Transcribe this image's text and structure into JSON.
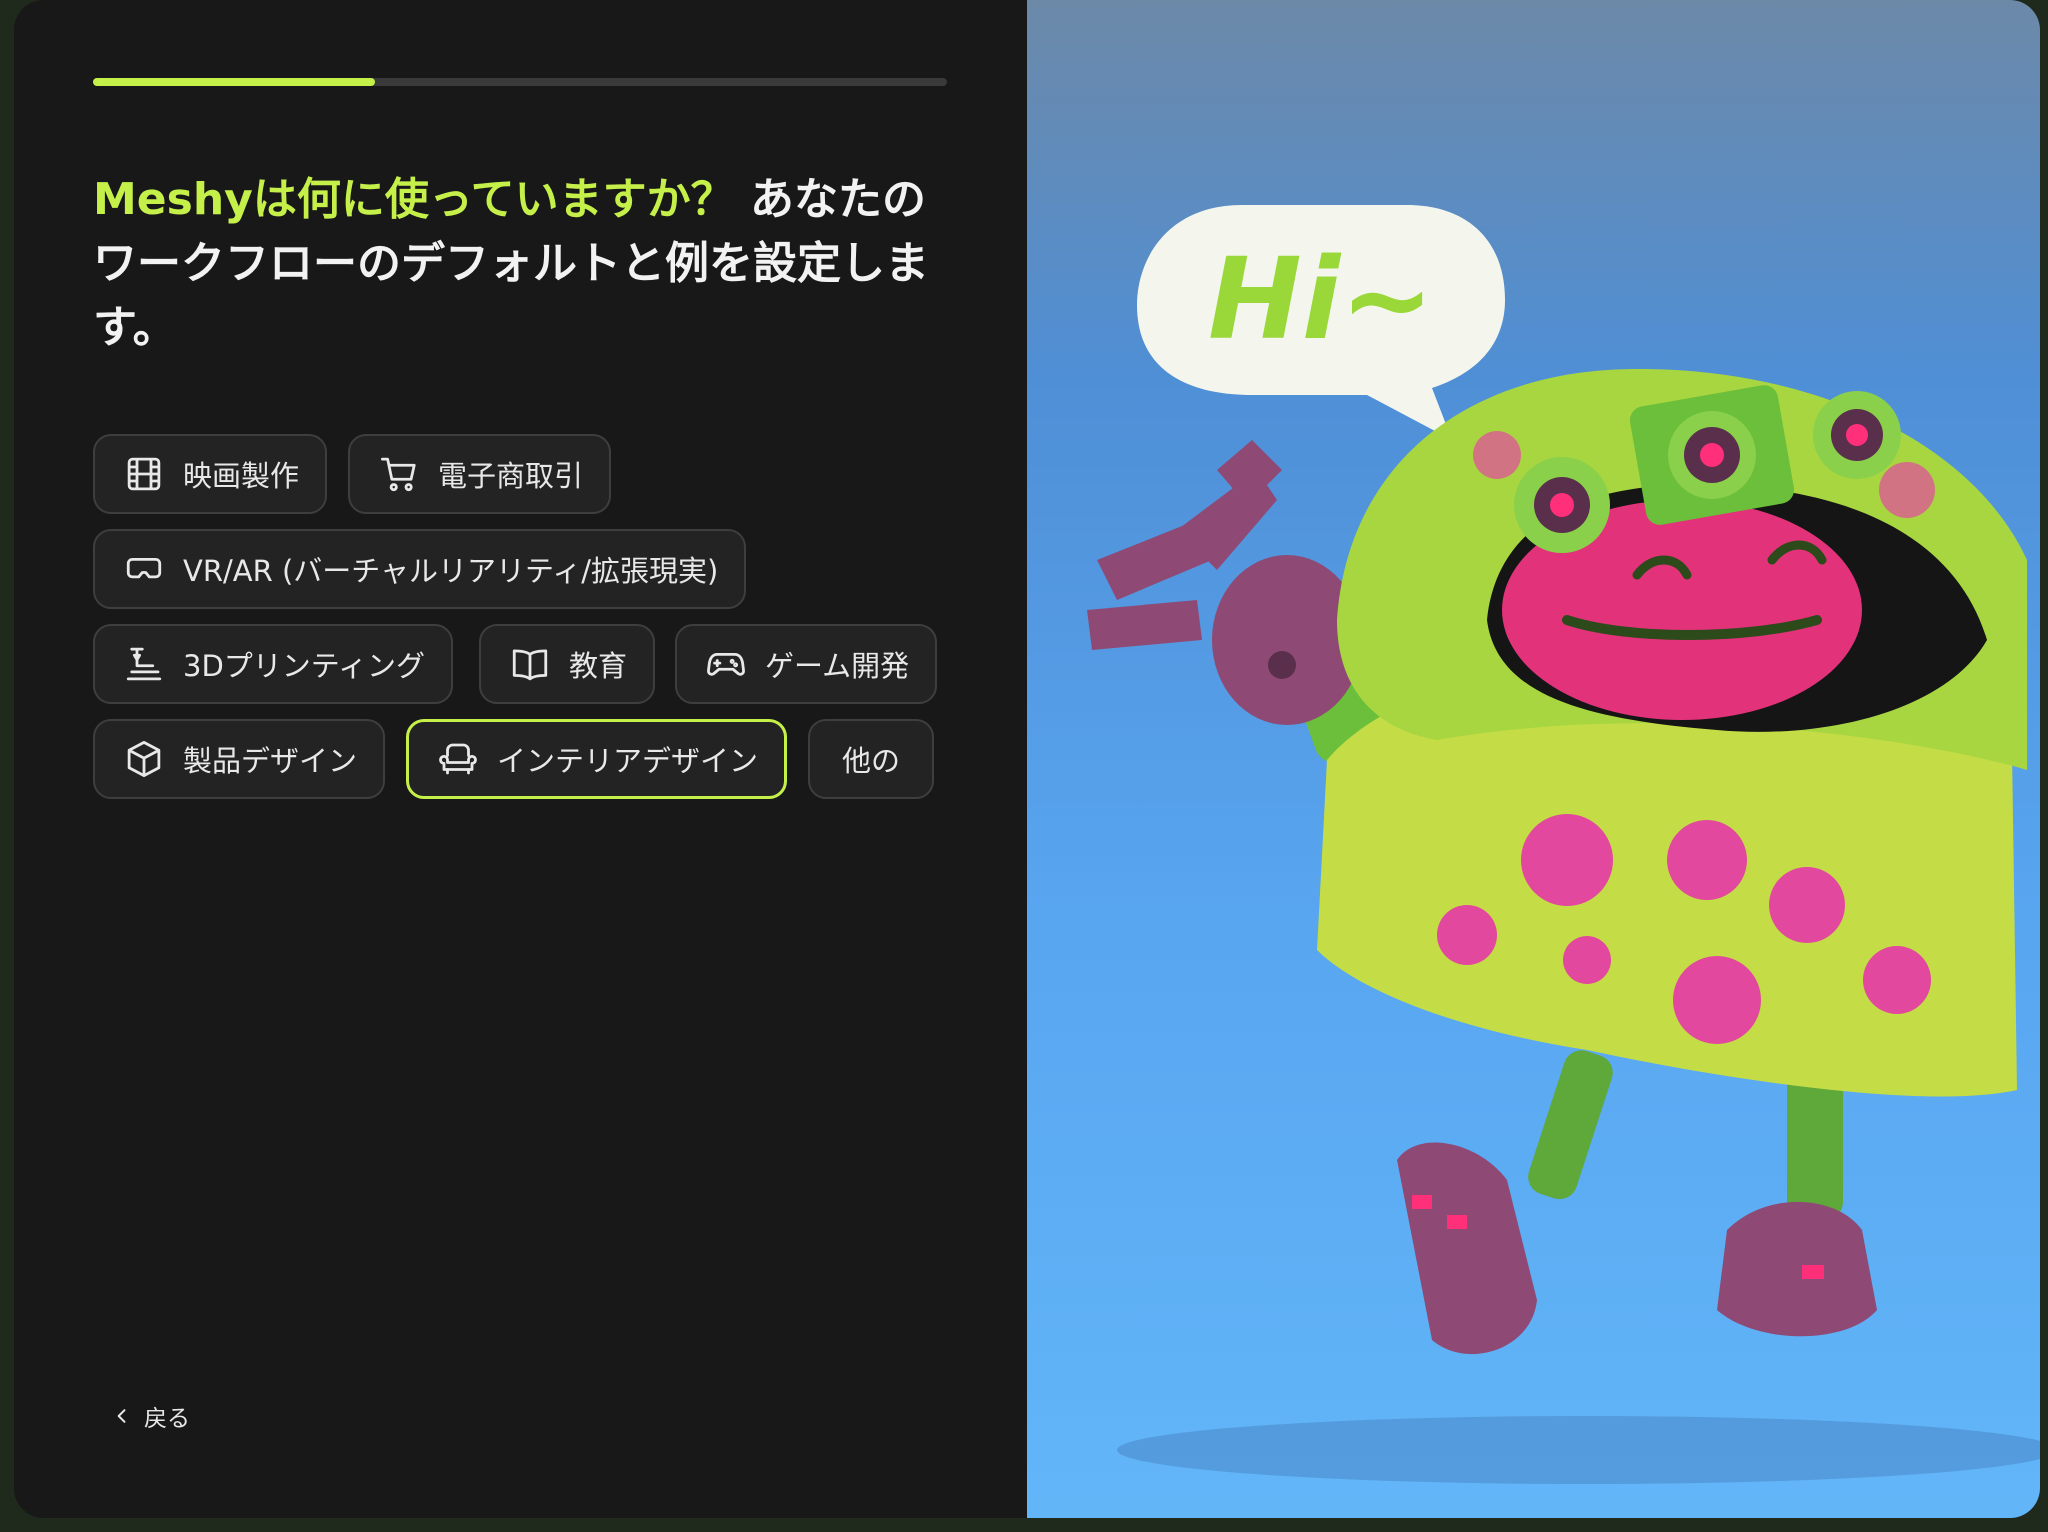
{
  "progress": {
    "fraction": 0.33
  },
  "question": {
    "highlight": "Meshyは何に使っていますか？",
    "rest": " あなたのワークフローのデフォルトと例を設定します。"
  },
  "options": [
    {
      "label": "映画製作",
      "icon": "film-icon",
      "selected": false
    },
    {
      "label": "電子商取引",
      "icon": "cart-icon",
      "selected": false
    },
    {
      "label": "VR/AR (バーチャルリアリティ/拡張現実)",
      "icon": "vr-headset-icon",
      "selected": false
    },
    {
      "label": "3Dプリンティング",
      "icon": "printer-3d-icon",
      "selected": false
    },
    {
      "label": "教育",
      "icon": "book-icon",
      "selected": false
    },
    {
      "label": "ゲーム開発",
      "icon": "gamepad-icon",
      "selected": false
    },
    {
      "label": "製品デザイン",
      "icon": "cube-icon",
      "selected": false
    },
    {
      "label": "インテリアデザイン",
      "icon": "armchair-icon",
      "selected": true
    },
    {
      "label": "他の",
      "icon": "",
      "selected": false
    }
  ],
  "back": {
    "label": "戻る",
    "icon": "chevron-left-icon"
  },
  "illustration": {
    "speech_bubble_text": "Hi~"
  },
  "colors": {
    "accent": "#c5f04a",
    "panel": "#181818",
    "chip_border": "#3e3e3e"
  }
}
